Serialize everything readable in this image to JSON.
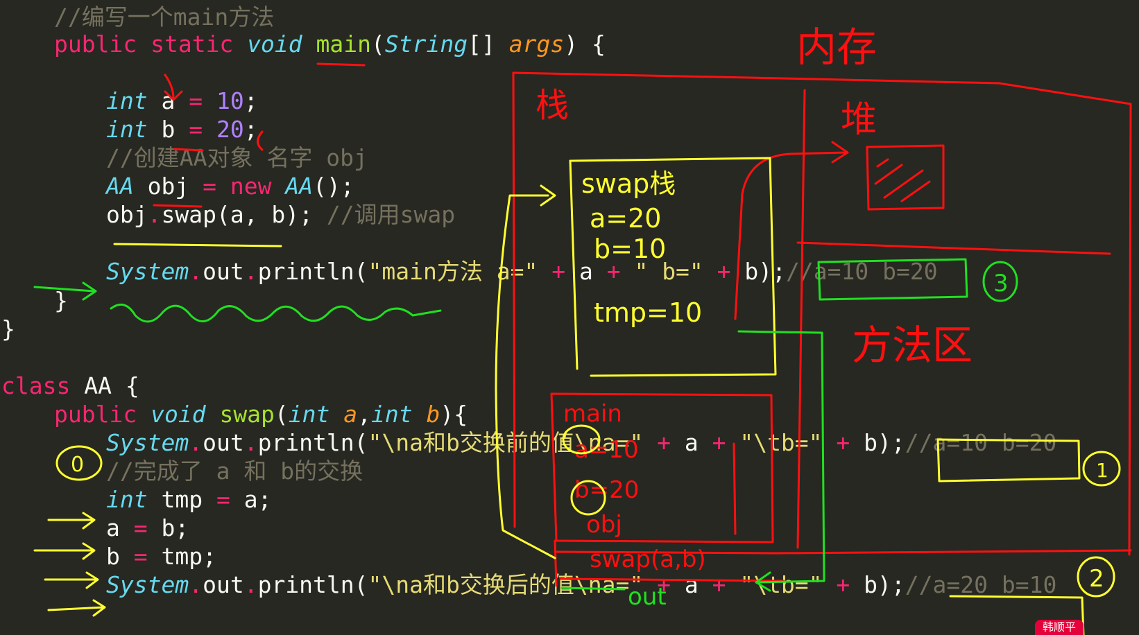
{
  "code": {
    "l1": {
      "comment": "//编写一个main方法"
    },
    "l2": {
      "kw1": "public",
      "kw2": "static",
      "type": "void",
      "fn": "main",
      "p1": "(",
      "ptype": "String",
      "p2": "[] ",
      "param": "args",
      "p3": ") {"
    },
    "l3": {
      "type": "int",
      "rest": " a ",
      "op": "=",
      "sp": " ",
      "num": "10",
      "semi": ";"
    },
    "l4": {
      "type": "int",
      "rest": " b ",
      "op": "=",
      "sp": " ",
      "num": "20",
      "semi": ";"
    },
    "l5": {
      "comment": "//创建AA对象 名字 obj"
    },
    "l6": {
      "type": "AA",
      "rest": " obj ",
      "op": "=",
      "sp": " ",
      "kw": "new",
      "sp2": " ",
      "type2": "AA",
      "end": "();"
    },
    "l7": {
      "obj": "obj",
      "dot": ".",
      "call": "swap(a, b); ",
      "comment": "//调用swap"
    },
    "l8": {
      "type": "System",
      "dot1": ".",
      "out": "out",
      "dot2": ".",
      "call": "println(",
      "s1": "\"main方法 a=\"",
      "sp1": " ",
      "plus1": "+",
      "a": " a ",
      "plus2": "+",
      "sp2": " ",
      "s2": "\" b=\"",
      "sp3": " ",
      "plus3": "+",
      "b": " b);",
      "comment": "//a=10 b=20"
    },
    "l9": {
      "text": "}"
    },
    "l10": {
      "text": "}"
    },
    "l11": {
      "kw": "class",
      "rest": " AA {"
    },
    "l12": {
      "kw": "public",
      "sp": " ",
      "type": "void",
      "fn": " swap",
      "p1": "(",
      "ptype1": "int",
      "sp2": " ",
      "param1": "a",
      "comma": ",",
      "ptype2": "int",
      "sp3": " ",
      "param2": "b",
      "end": "){"
    },
    "l13": {
      "type": "System",
      "dot1": ".",
      "out": "out",
      "dot2": ".",
      "call": "println(",
      "s1": "\"\\na和b交换前的值\\na=\"",
      "sp1": " ",
      "plus1": "+",
      "a": " a ",
      "plus2": "+",
      "sp2": " ",
      "s2": "\"\\tb=\"",
      "sp3": " ",
      "plus3": "+",
      "b": " b);",
      "comment": "//a=10 b=20"
    },
    "l14": {
      "comment": "//完成了 a 和 b的交换"
    },
    "l15": {
      "type": "int",
      "rest": " tmp ",
      "op": "=",
      "end": " a;"
    },
    "l16": {
      "a": "a ",
      "op": "=",
      "end": " b;"
    },
    "l17": {
      "b": "b ",
      "op": "=",
      "end": " tmp;"
    },
    "l18": {
      "type": "System",
      "dot1": ".",
      "out": "out",
      "dot2": ".",
      "call": "println(",
      "s1": "\"\\na和b交换后的值\\na=\"",
      "sp1": " ",
      "plus1": "+",
      "a": " a ",
      "plus2": "+",
      "sp2": " ",
      "s2": "\"\\tb=\"",
      "sp3": " ",
      "plus3": "+",
      "b": " b);",
      "comment": "//a=20 b=10"
    }
  },
  "annotations": {
    "memory_label": "内存",
    "stack_label": "栈",
    "heap_label": "堆",
    "method_area_label": "方法区",
    "swap_frame_title": "swap栈",
    "swap_a": "a=20",
    "swap_b": "b=10",
    "swap_tmp": "tmp=10",
    "main_frame_title": "main",
    "main_a": "a=10",
    "main_b": "b=20",
    "main_obj": "obj",
    "call_label": "swap(a,b)",
    "out_label": "out",
    "circle_0": "0",
    "circle_1": "1",
    "circle_2": "2",
    "circle_3": "3"
  },
  "watermark": {
    "text": "韩顺平"
  },
  "colors": {
    "background": "#272822",
    "red_ink": "#ff1010",
    "yellow_ink": "#ffff30",
    "green_ink": "#20e020"
  }
}
